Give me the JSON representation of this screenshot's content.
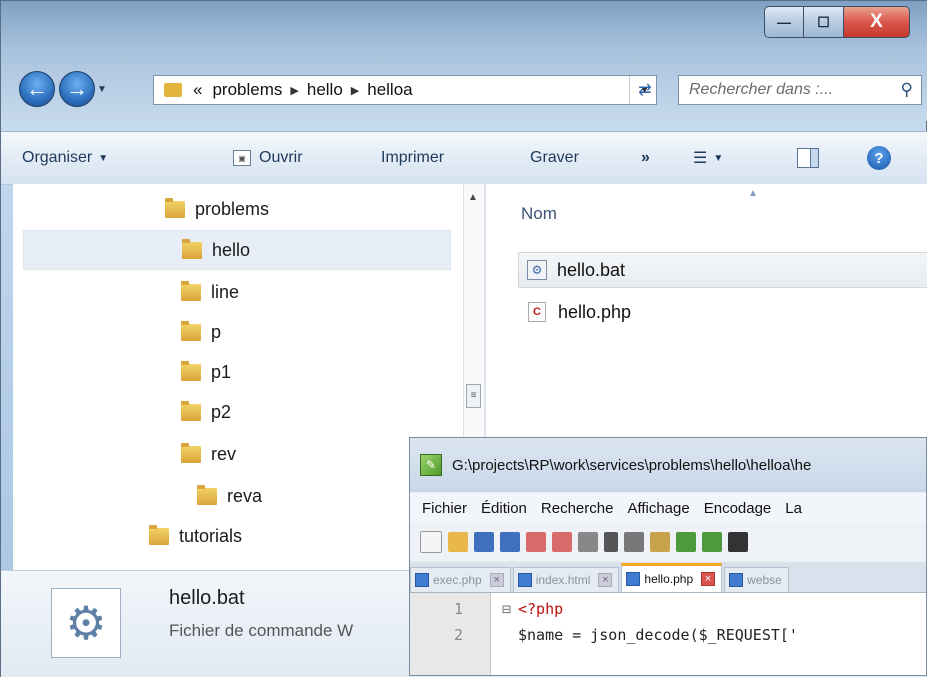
{
  "window": {
    "controls": {
      "minimize": "—",
      "maximize": "☐",
      "close": "X"
    }
  },
  "address_bar": {
    "overflow": "«",
    "segments": [
      "problems",
      "hello",
      "helloa"
    ]
  },
  "search": {
    "placeholder": "Rechercher dans :..."
  },
  "toolbar": {
    "organize": "Organiser",
    "open": "Ouvrir",
    "print": "Imprimer",
    "burn": "Graver",
    "more": "»"
  },
  "nav_tree": {
    "items": [
      {
        "label": "problems",
        "selected": false
      },
      {
        "label": "hello",
        "selected": true
      },
      {
        "label": "line",
        "selected": false
      },
      {
        "label": "p",
        "selected": false
      },
      {
        "label": "p1",
        "selected": false
      },
      {
        "label": "p2",
        "selected": false
      },
      {
        "label": "rev",
        "selected": false
      },
      {
        "label": "reva",
        "selected": false
      },
      {
        "label": "tutorials",
        "selected": false
      }
    ]
  },
  "content": {
    "column_header": "Nom",
    "files": [
      {
        "name": "hello.bat",
        "icon": "batch-file-icon"
      },
      {
        "name": "hello.php",
        "icon": "php-file-icon"
      }
    ]
  },
  "details": {
    "name": "hello.bat",
    "type": "Fichier de commande W"
  },
  "notepad": {
    "title": "G:\\projects\\RP\\work\\services\\problems\\hello\\helloa\\he",
    "menu": [
      "Fichier",
      "Édition",
      "Recherche",
      "Affichage",
      "Encodage",
      "La"
    ],
    "tabs": [
      {
        "label": "exec.php",
        "active": false
      },
      {
        "label": "index.html",
        "active": false
      },
      {
        "label": "hello.php",
        "active": true
      },
      {
        "label": "webse",
        "active": false
      }
    ],
    "lines": [
      {
        "number": "1",
        "fold": "⊟",
        "code": "<?php"
      },
      {
        "number": "2",
        "fold": "",
        "code": "$name = json_decode($_REQUEST['"
      }
    ]
  },
  "colors": {
    "close_button": "#d9574a",
    "tab_active_accent": "#f5a623",
    "php_tag": "#c01010",
    "variable": "#0a3fb8"
  }
}
